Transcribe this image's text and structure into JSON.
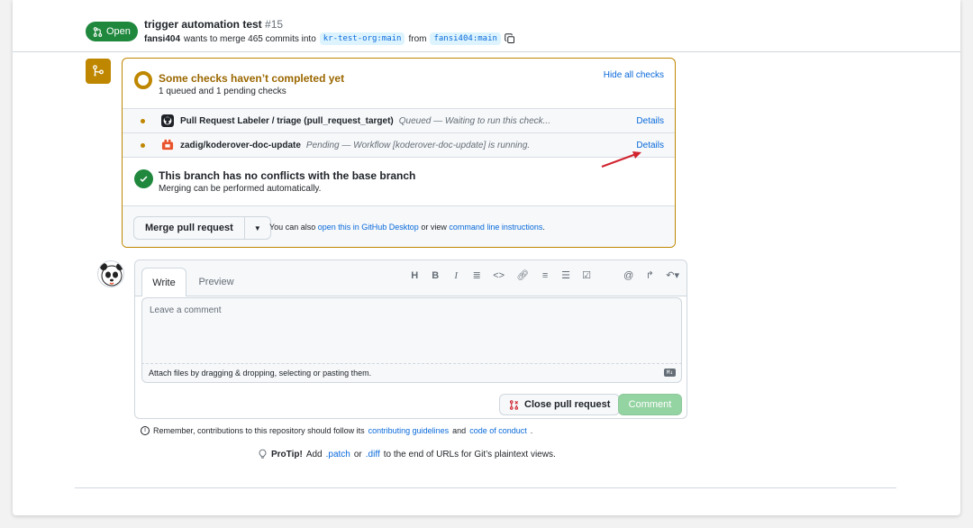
{
  "header": {
    "state": "Open",
    "title": "trigger automation test",
    "number": "#15",
    "author": "fansi404",
    "merge_text": "wants to merge 465 commits into",
    "base_branch": "kr-test-org:main",
    "from_text": "from",
    "head_branch": "fansi404:main"
  },
  "checks": {
    "title": "Some checks haven’t completed yet",
    "subtitle": "1 queued and 1 pending checks",
    "hide_all": "Hide all checks",
    "items": [
      {
        "name": "Pull Request Labeler / triage (pull_request_target)",
        "description": "Queued — Waiting to run this check...",
        "details": "Details"
      },
      {
        "name": "zadig/koderover-doc-update",
        "description": "Pending — Workflow [koderover-doc-update] is running.",
        "details": "Details"
      }
    ]
  },
  "conflicts": {
    "title": "This branch has no conflicts with the base branch",
    "subtitle": "Merging can be performed automatically."
  },
  "merge": {
    "button": "Merge pull request",
    "also_prefix": "You can also",
    "desktop_link": "open this in GitHub Desktop",
    "or_view": "or view",
    "cli_link": "command line instructions",
    "period": "."
  },
  "comment": {
    "tab_write": "Write",
    "tab_preview": "Preview",
    "toolbar": [
      "H",
      "B",
      "I",
      "≣",
      "<>",
      "☰",
      "≡",
      "☰",
      "☑",
      "@",
      "↱",
      "↶▾"
    ],
    "placeholder": "Leave a comment",
    "attach": "Attach files by dragging & dropping, selecting or pasting them.",
    "close_button": "Close pull request",
    "comment_button": "Comment"
  },
  "remember": {
    "prefix": "Remember, contributions to this repository should follow its",
    "guidelines_link": "contributing guidelines",
    "and": "and",
    "conduct_link": "code of conduct",
    "period": "."
  },
  "protip": {
    "label": "ProTip!",
    "add": "Add",
    "patch": ".patch",
    "or": "or",
    "diff": ".diff",
    "suffix": "to the end of URLs for Git’s plaintext views."
  },
  "colors": {
    "open_green": "#1f883d",
    "pending_amber": "#bf8700",
    "link_blue": "#0969da",
    "annotation_red": "#d1242f"
  }
}
